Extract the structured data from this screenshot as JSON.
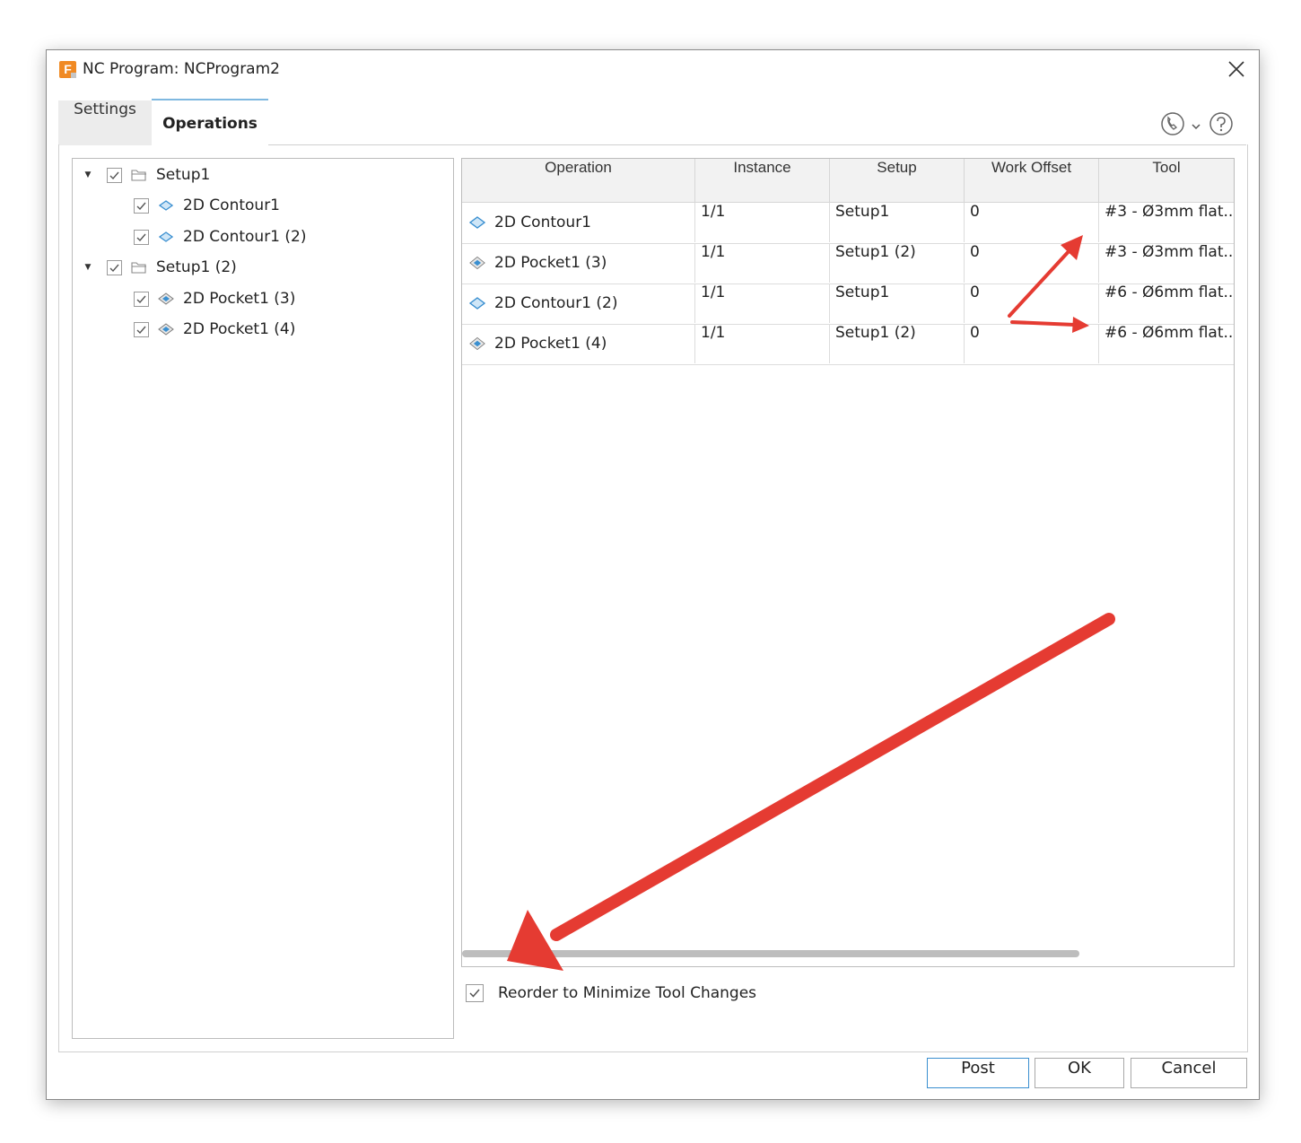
{
  "window": {
    "title": "NC Program: NCProgram2",
    "app_icon_letter": "F",
    "close_icon": "close-icon"
  },
  "tabs": [
    {
      "label": "Settings",
      "active": false
    },
    {
      "label": "Operations",
      "active": true
    }
  ],
  "header_icons": [
    "support-phone-icon",
    "chevron-down-icon",
    "help-icon"
  ],
  "tree": [
    {
      "label": "Setup1",
      "type": "setup",
      "checked": true,
      "expanded": true,
      "icon": "folder-icon",
      "children": [
        {
          "label": "2D Contour1",
          "icon": "contour-icon",
          "checked": true
        },
        {
          "label": "2D Contour1 (2)",
          "icon": "contour-icon",
          "checked": true
        }
      ]
    },
    {
      "label": "Setup1 (2)",
      "type": "setup",
      "checked": true,
      "expanded": true,
      "icon": "folder-icon",
      "children": [
        {
          "label": "2D Pocket1 (3)",
          "icon": "pocket-icon",
          "checked": true
        },
        {
          "label": "2D Pocket1 (4)",
          "icon": "pocket-icon",
          "checked": true
        }
      ]
    }
  ],
  "grid": {
    "columns": [
      "Operation",
      "Instance",
      "Setup",
      "Work Offset",
      "Tool"
    ],
    "rows": [
      {
        "operation": "2D Contour1",
        "icon": "contour-icon",
        "instance": "1/1",
        "setup": "Setup1",
        "work_offset": "0",
        "tool": "#3 - Ø3mm flat..."
      },
      {
        "operation": "2D Pocket1 (3)",
        "icon": "pocket-icon",
        "instance": "1/1",
        "setup": "Setup1 (2)",
        "work_offset": "0",
        "tool": "#3 - Ø3mm flat..."
      },
      {
        "operation": "2D Contour1 (2)",
        "icon": "contour-icon",
        "instance": "1/1",
        "setup": "Setup1",
        "work_offset": "0",
        "tool": "#6 - Ø6mm flat..."
      },
      {
        "operation": "2D Pocket1 (4)",
        "icon": "pocket-icon",
        "instance": "1/1",
        "setup": "Setup1 (2)",
        "work_offset": "0",
        "tool": "#6 - Ø6mm flat..."
      }
    ]
  },
  "reorder": {
    "label": "Reorder to Minimize Tool Changes",
    "checked": true
  },
  "buttons": {
    "post": "Post",
    "ok": "OK",
    "cancel": "Cancel"
  },
  "colors": {
    "annotation_arrow": "#e53b32",
    "accent": "#3a8fd0",
    "app_icon": "#f08a24"
  }
}
